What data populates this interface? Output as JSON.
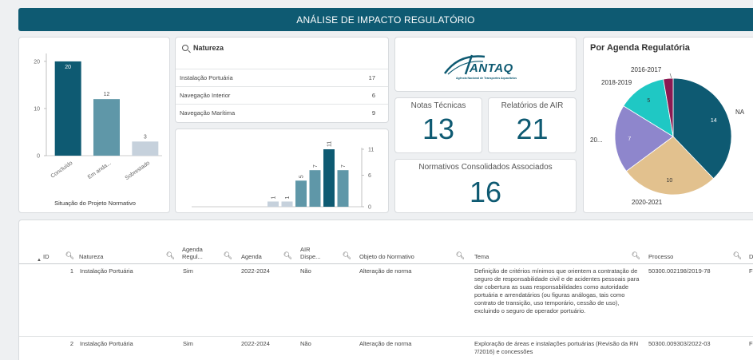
{
  "header": {
    "title": "ANÁLISE DE IMPACTO REGULATÓRIO"
  },
  "situacao_chart": {
    "title": "Situação do Projeto Normativo",
    "categories": [
      "Concluído",
      "Em anda...",
      "Sobrestado"
    ],
    "values": [
      20,
      12,
      3
    ],
    "y_ticks": [
      "0",
      "10",
      "20"
    ],
    "colors": [
      "#0e5a72",
      "#5f97a8",
      "#c6d1dc"
    ]
  },
  "natureza": {
    "title": "Natureza",
    "rows": [
      {
        "label": "Instalação Portuária",
        "count": "17"
      },
      {
        "label": "Navegação Interior",
        "count": "6"
      },
      {
        "label": "Navegação Marítima",
        "count": "9"
      }
    ]
  },
  "mini_chart": {
    "values": [
      1,
      1,
      5,
      7,
      11,
      7
    ],
    "y_ticks": [
      "0",
      "6",
      "11"
    ]
  },
  "logo": {
    "name": "ANTAQ",
    "subtitle": "Agência Nacional de Transportes Aquaviários"
  },
  "kpis": {
    "notas_label": "Notas Técnicas",
    "notas_value": "13",
    "relatorios_label": "Relatórios de AIR",
    "relatorios_value": "21",
    "normativos_label": "Normativos Consolidados Associados",
    "normativos_value": "16"
  },
  "pie": {
    "title": "Por Agenda Regulatória",
    "slices": [
      {
        "label": "NA",
        "value": 14,
        "color": "#0e5a72"
      },
      {
        "label": "2020-2021",
        "value": 10,
        "color": "#e2c18e"
      },
      {
        "label": "20...",
        "value": 7,
        "color": "#8e86cc"
      },
      {
        "label": "2018-2019",
        "value": 5,
        "color": "#1fc8c4"
      },
      {
        "label": "2016-2017",
        "value": 1,
        "color": "#8b1a52"
      }
    ]
  },
  "table": {
    "headers": [
      "ID",
      "Natureza",
      "Agenda Regul...",
      "Agenda",
      "AIR Dispe...",
      "Objeto do Normativo",
      "Tema",
      "Processo"
    ],
    "rows": [
      {
        "id": "1",
        "natureza": "Instalação Portuária",
        "agenda_reg": "Sim",
        "agenda": "2022-2024",
        "air": "Não",
        "objeto": "Alteração de norma",
        "tema": "Definição de critérios mínimos que orientem a contratação de seguro de responsabilidade civil e de acidentes pessoais para dar cobertura as suas responsabilidades como autoridade portuária e arrendatários (ou figuras análogas, tais como contrato de transição, uso temporário, cessão de uso), excluindo o seguro de operador portuário.",
        "processo": "50300.002198/2019-78",
        "extra": "F"
      },
      {
        "id": "2",
        "natureza": "Instalação Portuária",
        "agenda_reg": "Sim",
        "agenda": "2022-2024",
        "air": "Não",
        "objeto": "Alteração de norma",
        "tema": "Exploração de áreas e instalações portuárias (Revisão da RN 7/2016) e concessões",
        "processo": "50300.009303/2022-03",
        "extra": "F"
      }
    ]
  }
}
